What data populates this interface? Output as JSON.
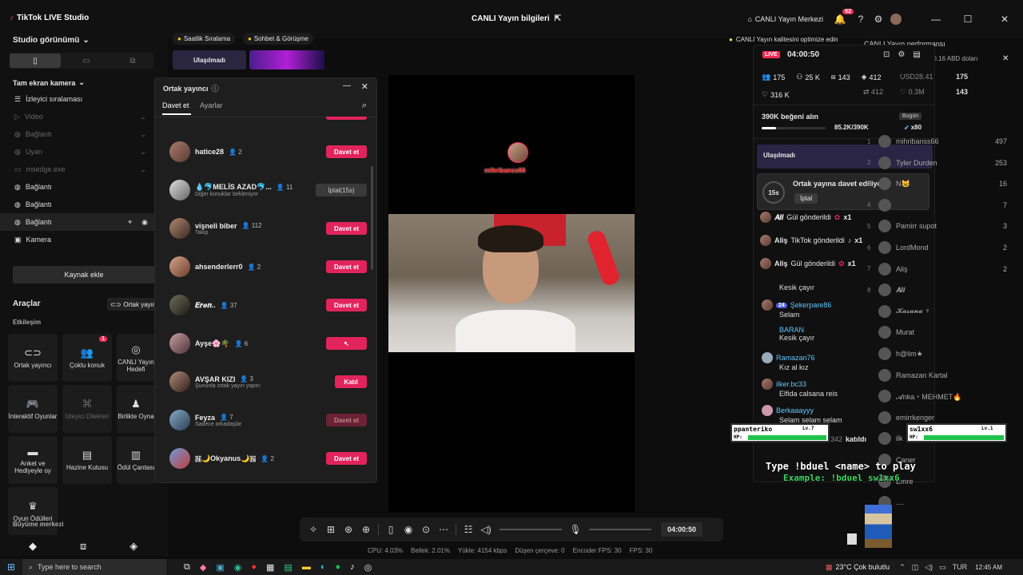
{
  "titlebar": {
    "app_title": "TikTok LIVE Studio",
    "center_title": "CANLI Yayın bilgileri",
    "live_center": "CANLI Yayın Merkezi",
    "notif_count": "62"
  },
  "left": {
    "studio_view": "Studio görünümü",
    "scene": "Tam ekran kamera",
    "sources": [
      {
        "label": "İzleyici sıralaması",
        "dim": false
      },
      {
        "label": "Video",
        "dim": true
      },
      {
        "label": "Bağlantı",
        "dim": true
      },
      {
        "label": "Uyarı",
        "dim": true
      },
      {
        "label": "msedge.exe",
        "dim": true
      },
      {
        "label": "Bağlantı",
        "dim": false
      },
      {
        "label": "Bağlantı",
        "dim": false
      },
      {
        "label": "Bağlantı",
        "dim": false
      },
      {
        "label": "Kamera",
        "dim": false
      }
    ],
    "add_source": "Kaynak ekle",
    "tools_title": "Araçlar",
    "cohost_chip": "Ortak yayın",
    "interaction": "Etkileşim",
    "tools": [
      {
        "label": "Ortak yayıncı",
        "icon": "link-icon"
      },
      {
        "label": "Çoklu konuk",
        "icon": "users-icon",
        "badge": "1"
      },
      {
        "label": "CANLI Yayın Hedefi",
        "icon": "target-icon"
      },
      {
        "label": "İnteraktif Oyunlar",
        "icon": "gamepad-icon"
      },
      {
        "label": "İzleyici Dilekleri",
        "icon": "gift-icon",
        "dim": true
      },
      {
        "label": "Birlikte Oyna",
        "icon": "player-icon"
      },
      {
        "label": "Anket ve Hediyeyle oy",
        "icon": "poll-icon"
      },
      {
        "label": "Hazine Kutusu",
        "icon": "chest-icon"
      },
      {
        "label": "Ödül Çantası",
        "icon": "bag-icon"
      },
      {
        "label": "Oyun Ödülleri",
        "icon": "trophy-icon"
      }
    ],
    "growth": "Büyüme merkezi"
  },
  "top_chips": {
    "hourly": "Saatlik Sıralama",
    "chat": "Sohbet & Görüşme",
    "reached": "Ulaşılmadı"
  },
  "modal": {
    "title": "Ortak yayıncı",
    "tab_invite": "Davet et",
    "tab_settings": "Ayarlar",
    "users": [
      {
        "name": "hatice28",
        "count": "2",
        "sub": "",
        "btn": "Davet et",
        "style": "pink"
      },
      {
        "name": "💧🐬MELİS AZAD🐬...",
        "count": "11",
        "sub": "Diğer konuklar bekleniyor",
        "btn": "İptal(15s)",
        "style": "grey"
      },
      {
        "name": "vişneli biber",
        "count": "112",
        "sub": "Takip",
        "btn": "Davet et",
        "style": "pink"
      },
      {
        "name": "ahsenderlerr0",
        "count": "2",
        "sub": "",
        "btn": "Davet et",
        "style": "pink"
      },
      {
        "name": "𝑬𝒓𝒆𝒏..",
        "count": "37",
        "sub": "",
        "btn": "Davet et",
        "style": "pink"
      },
      {
        "name": "Ayşe🌸🌴",
        "count": "6",
        "sub": "",
        "btn": "",
        "style": "pink"
      },
      {
        "name": "AVŞAR KIZI",
        "count": "3",
        "sub": "Şununla ortak yayın yapın:",
        "btn": "Katıl",
        "style": "pink"
      },
      {
        "name": "Feyza",
        "count": "7",
        "sub": "Sadece arkadaşlar",
        "btn": "Davet et",
        "style": "faded"
      },
      {
        "name": "🇳🌙Okyanus🌙🇳",
        "count": "2",
        "sub": "",
        "btn": "Davet et",
        "style": "pink"
      }
    ]
  },
  "video": {
    "watermark": "mihribanss66"
  },
  "right": {
    "optimize_tip": "CANLI Yayın kalitesini optimize edin",
    "perf_title": "CANLI Yayın performansı",
    "earn_tip": "Bu CANLI yayında +0.16 ABD doları",
    "live_badge": "LIVE",
    "timer": "04:00:50",
    "viewers": "175",
    "followers": "25 K",
    "gifts": "143",
    "diamonds": "412",
    "likes_total": "316 K",
    "usd": "USD28.41",
    "usd_viewers": "175",
    "ghost_412": "412",
    "ghost_likes": "0.3M",
    "ghost_143": "143",
    "likes_goal": "390K beğeni alın",
    "likes_progress": "85.2K/390K",
    "likes_fraction": 0.22,
    "today": "Bugün",
    "x80": "x80",
    "reached": "Ulaşılmadı",
    "invite_popup": "Ortak yayına davet ediliyor...",
    "invite_timer": "15s",
    "cancel": "İptal",
    "gift_lines": [
      {
        "name": "𝑨𝒍𝒊",
        "text": "Gül gönderildi",
        "x": "x1"
      },
      {
        "name": "Aliş",
        "text": "TikTok gönderildi",
        "x": "x1"
      },
      {
        "name": "Aliş",
        "text": "Gül gönderildi",
        "x": "x1"
      }
    ],
    "chat": [
      {
        "name": "",
        "text": "Kesik çayır"
      },
      {
        "name": "Şekerpare86",
        "text": "Selam"
      },
      {
        "name": "BARAN",
        "text": "Kesik çayır"
      },
      {
        "name": "Ramazan76",
        "text": "Kız al kız"
      },
      {
        "name": "ilker.bc33",
        "text": "Elfida calsana reis"
      },
      {
        "name": "Berkaaayyy",
        "text": "Selam selam selam"
      }
    ],
    "joined": "katıldı",
    "joined_num": "342"
  },
  "ranking": [
    {
      "rank": "1",
      "name": "mihribanss66",
      "score": "497"
    },
    {
      "rank": "2",
      "name": "Tyler Durden",
      "score": "253"
    },
    {
      "rank": "3",
      "name": "N😺",
      "score": "16"
    },
    {
      "rank": "4",
      "name": "",
      "score": "7"
    },
    {
      "rank": "5",
      "name": "Pamirr supot",
      "score": "3"
    },
    {
      "rank": "6",
      "name": "LordMond",
      "score": "2"
    },
    {
      "rank": "7",
      "name": "Aliş",
      "score": "2"
    },
    {
      "rank": "8",
      "name": "𝑨𝒍𝒊",
      "score": ""
    },
    {
      "rank": "",
      "name": "𝓚𝓪𝓼𝓪𝓷𝓪 ♆",
      "score": ""
    },
    {
      "rank": "",
      "name": "Murat",
      "score": ""
    },
    {
      "rank": "",
      "name": "h@lim★",
      "score": ""
    },
    {
      "rank": "",
      "name": "Ramazan Kartal",
      "score": ""
    },
    {
      "rank": "",
      "name": "𝓐nka・MEHMET🔥",
      "score": ""
    },
    {
      "rank": "",
      "name": "emirrkenger",
      "score": ""
    },
    {
      "rank": "",
      "name": "ilk",
      "score": ""
    },
    {
      "rank": "",
      "name": "Caner",
      "score": ""
    },
    {
      "rank": "",
      "name": "Emre",
      "score": ""
    },
    {
      "rank": "",
      "name": "....",
      "score": ""
    }
  ],
  "game": {
    "p1": "ppanteriko",
    "p1_lv": "Lv.7",
    "p2": "sw1xx6",
    "p2_lv": "Lv.1",
    "hp": "HP:",
    "line1": "Type !bduel <name> to play",
    "line2": "Example: !bduel sw1xx6"
  },
  "controls": {
    "timer": "04:00:50"
  },
  "stats": {
    "cpu": "CPU: 4.03%",
    "mem": "Bellek: 2.01%",
    "upload": "Yükle: 4154 kbps",
    "drop": "Düşen çerçeve: 0",
    "enc": "Encoder FPS: 30",
    "fps": "FPS: 30"
  },
  "taskbar": {
    "search": "Type here to search",
    "weather": "23°C  Çok bulutlu",
    "lang": "TUR",
    "time": "12:45 AM"
  }
}
